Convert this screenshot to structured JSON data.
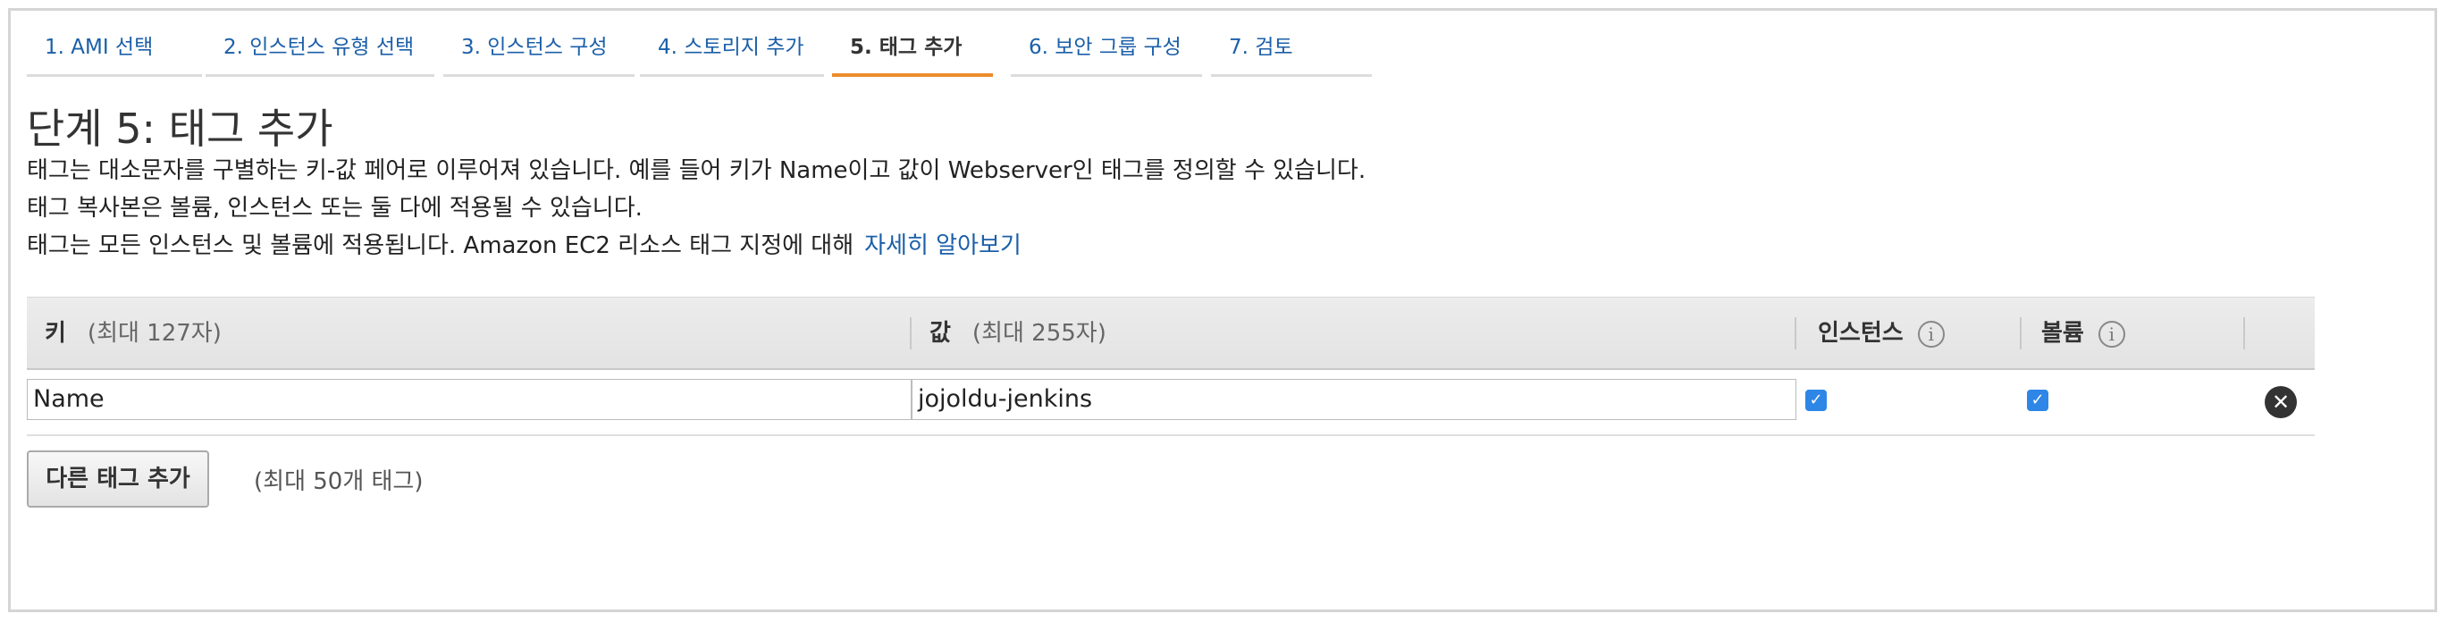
{
  "tabs": [
    {
      "label": "1. AMI 선택"
    },
    {
      "label": "2. 인스턴스 유형 선택"
    },
    {
      "label": "3. 인스턴스 구성"
    },
    {
      "label": "4. 스토리지 추가"
    },
    {
      "label": "5. 태그 추가",
      "active": true
    },
    {
      "label": "6. 보안 그룹 구성"
    },
    {
      "label": "7. 검토"
    }
  ],
  "page": {
    "title": "단계 5: 태그 추가",
    "desc1": "태그는 대소문자를 구별하는 키-값 페어로 이루어져 있습니다. 예를 들어 키가 Name이고 값이 Webserver인 태그를 정의할 수 있습니다.",
    "desc2": "태그 복사본은 볼륨, 인스턴스 또는 둘 다에 적용될 수 있습니다.",
    "desc3": "태그는 모든 인스턴스 및 볼륨에 적용됩니다. Amazon EC2 리소스 태그 지정에 대해",
    "learn_more": "자세히 알아보기"
  },
  "table": {
    "col_key": "키",
    "col_key_hint": "(최대 127자)",
    "col_value": "값",
    "col_value_hint": "(최대 255자)",
    "col_instances": "인스턴스",
    "col_volumes": "볼륨",
    "info_glyph": "i",
    "rows": [
      {
        "key": "Name",
        "value": "jojoldu-jenkins",
        "instances": true,
        "volumes": true
      }
    ]
  },
  "actions": {
    "add_tag": "다른 태그 추가",
    "add_tag_hint": "(최대 50개 태그)"
  },
  "icons": {
    "check": "✓",
    "remove": "✕"
  },
  "colors": {
    "link": "#1b5fa8",
    "active_tab": "#ec8b2c",
    "checkbox": "#2e86e6"
  }
}
